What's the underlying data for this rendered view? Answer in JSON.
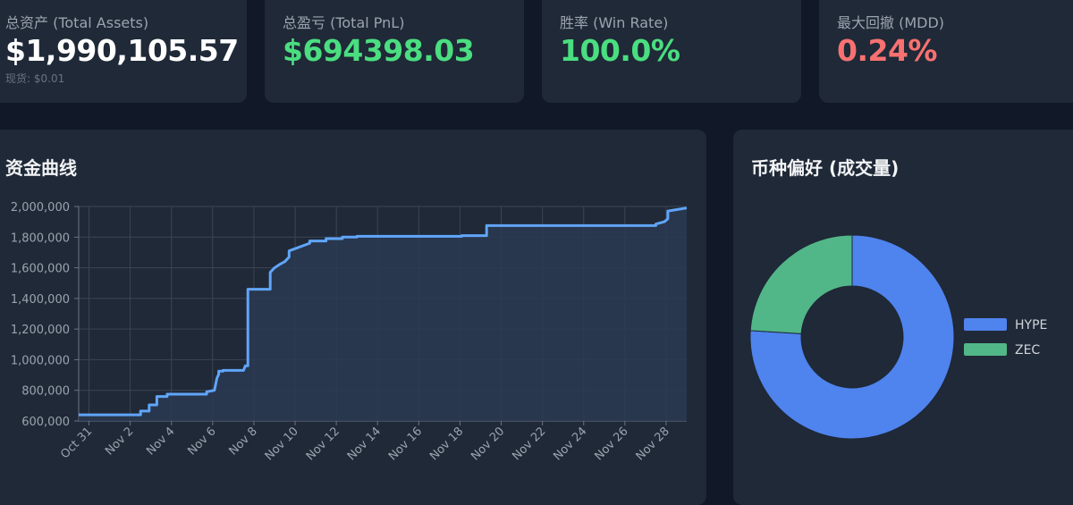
{
  "stats": [
    {
      "label": "总资产 (Total Assets)",
      "value": "$1,990,105.57",
      "sub": "现货: $0.01",
      "color": "#ffffff"
    },
    {
      "label": "总盈亏 (Total PnL)",
      "value": "$694398.03",
      "sub": "",
      "color": "#4ade80"
    },
    {
      "label": "胜率 (Win Rate)",
      "value": "100.0%",
      "sub": "",
      "color": "#4ade80"
    },
    {
      "label": "最大回撤 (MDD)",
      "value": "0.24%",
      "sub": "",
      "color": "#f87171"
    }
  ],
  "equity_panel": {
    "title": "资金曲线"
  },
  "coin_panel": {
    "title": "币种偏好 (成交量)"
  },
  "chart_data": [
    {
      "type": "line",
      "title": "资金曲线",
      "y_ticks": [
        "600,000",
        "800,000",
        "1,000,000",
        "1,200,000",
        "1,400,000",
        "1,600,000",
        "1,800,000",
        "2,000,000"
      ],
      "ylim": [
        600000,
        2000000
      ],
      "x_ticks": [
        "Oct 31",
        "Nov 2",
        "Nov 4",
        "Nov 6",
        "Nov 8",
        "Nov 10",
        "Nov 12",
        "Nov 14",
        "Nov 16",
        "Nov 18",
        "Nov 20",
        "Nov 22",
        "Nov 24",
        "Nov 26",
        "Nov 28"
      ],
      "xlim": [
        "2025-10-30T12:00",
        "2025-11-29T00:00"
      ],
      "grid": true,
      "line_color": "#60a5fa",
      "fill_color": "#2a3a52",
      "x": [
        "2025-10-30T12:00",
        "2025-11-02T12:00",
        "2025-11-02T12:00",
        "2025-11-02T22:00",
        "2025-11-02T22:00",
        "2025-11-03T07:00",
        "2025-11-03T07:00",
        "2025-11-03T19:00",
        "2025-11-03T19:00",
        "2025-11-05T17:00",
        "2025-11-05T17:00",
        "2025-11-06T02:00",
        "2025-11-06T05:00",
        "2025-11-06T07:00",
        "2025-11-06T07:00",
        "2025-11-06T12:00",
        "2025-11-06T12:00",
        "2025-11-07T12:00",
        "2025-11-07T14:00",
        "2025-11-07T17:00",
        "2025-11-07T17:00",
        "2025-11-08T19:00",
        "2025-11-08T19:00",
        "2025-11-09T00:00",
        "2025-11-09T07:00",
        "2025-11-09T12:00",
        "2025-11-09T17:00",
        "2025-11-09T17:00",
        "2025-11-10T17:00",
        "2025-11-10T17:00",
        "2025-11-11T12:00",
        "2025-11-11T12:00",
        "2025-11-12T07:00",
        "2025-11-12T07:00",
        "2025-11-13T00:00",
        "2025-11-13T00:00",
        "2025-11-18T02:00",
        "2025-11-18T02:00",
        "2025-11-19T07:00",
        "2025-11-19T07:00",
        "2025-11-27T12:00",
        "2025-11-27T12:00",
        "2025-11-27T22:00",
        "2025-11-28T02:00",
        "2025-11-28T02:00",
        "2025-11-29T00:00"
      ],
      "y": [
        640000,
        640000,
        665000,
        665000,
        705000,
        705000,
        760000,
        760000,
        775000,
        775000,
        790000,
        800000,
        880000,
        905000,
        925000,
        925000,
        930000,
        930000,
        960000,
        960000,
        1460000,
        1460000,
        1570000,
        1600000,
        1625000,
        1640000,
        1670000,
        1710000,
        1760000,
        1775000,
        1775000,
        1790000,
        1790000,
        1800000,
        1800000,
        1805000,
        1805000,
        1810000,
        1810000,
        1875000,
        1875000,
        1885000,
        1900000,
        1920000,
        1970000,
        1990000
      ]
    },
    {
      "type": "pie",
      "title": "币种偏好 (成交量)",
      "donut": true,
      "labels": [
        "HYPE",
        "ZEC"
      ],
      "values": [
        76,
        24
      ],
      "colors": [
        "#4f83ee",
        "#52b788"
      ],
      "legend": "right"
    }
  ]
}
